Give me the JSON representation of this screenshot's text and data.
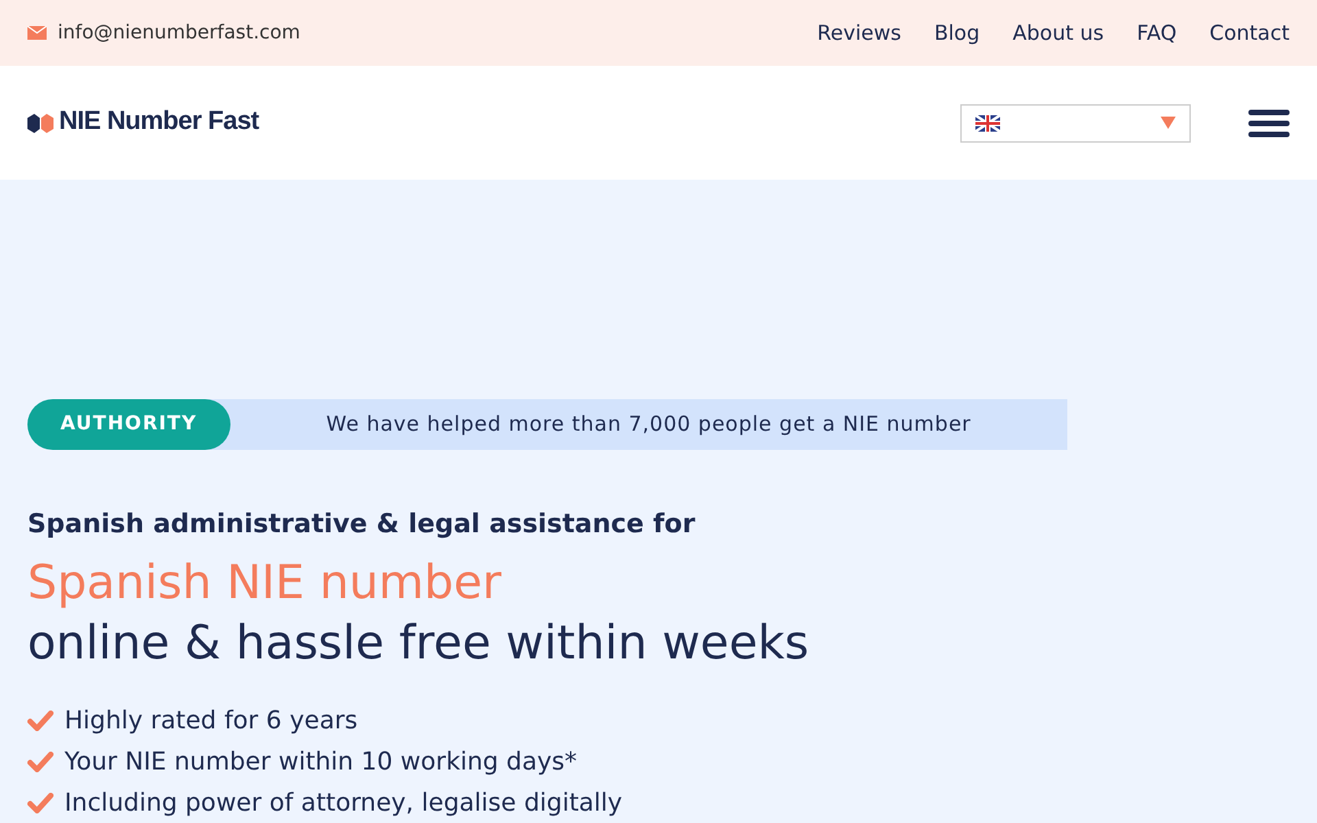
{
  "top_bar": {
    "email": "info@nienumberfast.com",
    "links": [
      {
        "label": "Reviews"
      },
      {
        "label": "Blog"
      },
      {
        "label": "About us"
      },
      {
        "label": "FAQ"
      },
      {
        "label": "Contact"
      }
    ]
  },
  "header": {
    "logo": "NIE Number Fast"
  },
  "hero": {
    "badge": "AUTHORITY",
    "badge_text": "We have helped more than 7,000 people get a NIE number",
    "subtitle": "Spanish administrative & legal assistance for",
    "headline_accent": "Spanish NIE number",
    "headline": "online & hassle free within weeks",
    "bullets": [
      "Highly rated for 6 years",
      "Your NIE number within 10 working days*",
      "Including power of attorney, legalise digitally"
    ]
  }
}
